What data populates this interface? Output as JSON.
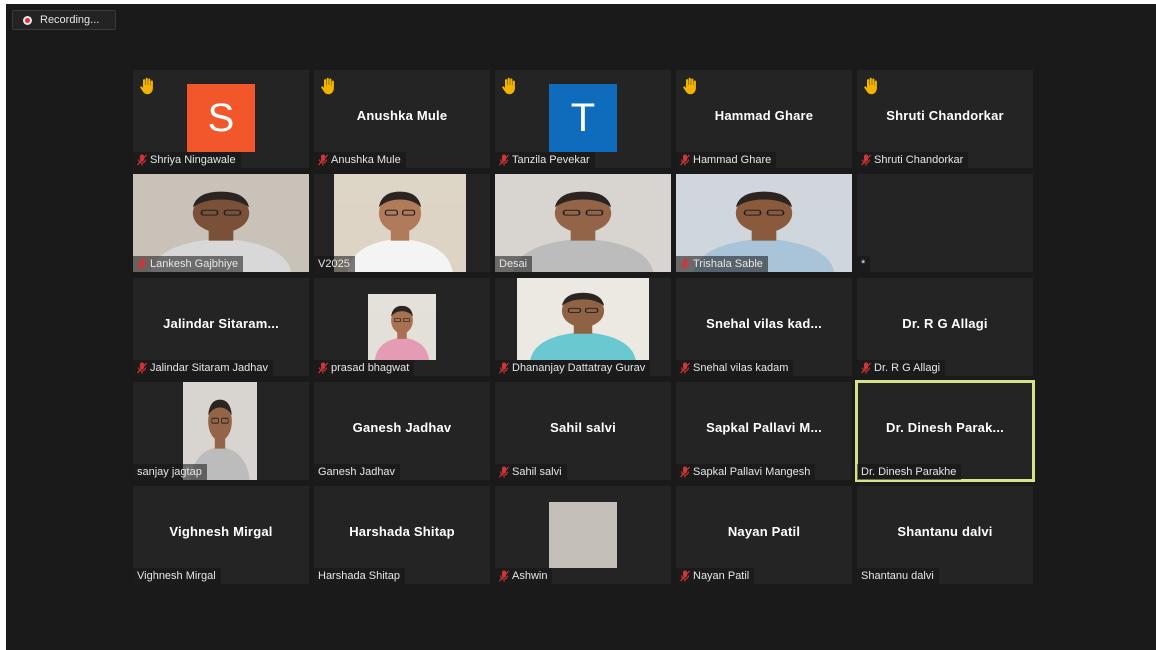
{
  "recording": {
    "label": "Recording..."
  },
  "colors": {
    "mute": "#d13438",
    "hand": "#f2b400",
    "active_border": "#d3e38a",
    "avatar_s": "#f1572a",
    "avatar_t": "#0f6cbd"
  },
  "tiles": [
    {
      "label": "Shriya Ningawale",
      "avatar_letter": "S",
      "hand": true,
      "muted": true
    },
    {
      "label": "Anushka Mule",
      "center": "Anushka Mule",
      "hand": true,
      "muted": true
    },
    {
      "label": "Tanzila Pevekar",
      "avatar_letter": "T",
      "hand": true,
      "muted": true
    },
    {
      "label": "Hammad Ghare",
      "center": "Hammad Ghare",
      "hand": true,
      "muted": true
    },
    {
      "label": "Shruti Chandorkar",
      "center": "Shruti Chandorkar",
      "hand": true,
      "muted": true
    },
    {
      "label": "Lankesh Gajbhiye",
      "video": "person",
      "muted": true
    },
    {
      "label": "V2025",
      "video": "person",
      "muted": false
    },
    {
      "label": "Desai",
      "video": "person",
      "muted": false
    },
    {
      "label": "Trishala Sable",
      "video": "person",
      "muted": true
    },
    {
      "label": "*",
      "muted": false
    },
    {
      "label": "Jalindar Sitaram Jadhav",
      "center": "Jalindar  Sitaram...",
      "muted": true
    },
    {
      "label": "prasad bhagwat",
      "video": "person",
      "muted": true
    },
    {
      "label": "Dhananjay Dattatray Gurav",
      "video": "person",
      "muted": true
    },
    {
      "label": "Snehal vilas kadam",
      "center": "Snehal  vilas  kad...",
      "muted": true
    },
    {
      "label": "Dr. R G Allagi",
      "center": "Dr. R G Allagi",
      "muted": true
    },
    {
      "label": "sanjay jagtap",
      "video": "person",
      "muted": false
    },
    {
      "label": "Ganesh Jadhav",
      "center": "Ganesh Jadhav",
      "muted": false
    },
    {
      "label": "Sahil salvi",
      "center": "Sahil salvi",
      "muted": true
    },
    {
      "label": "Sapkal Pallavi Mangesh",
      "center": "Sapkal  Pallavi  M...",
      "muted": true
    },
    {
      "label": "Dr. Dinesh Parakhe",
      "center": "Dr.  Dinesh  Parak...",
      "muted": false,
      "active": true
    },
    {
      "label": "Vighnesh Mirgal",
      "center": "Vighnesh Mirgal",
      "muted": false
    },
    {
      "label": "Harshada Shitap",
      "center": "Harshada Shitap",
      "muted": false
    },
    {
      "label": "Ashwin",
      "video": "blank",
      "muted": true
    },
    {
      "label": "Nayan Patil",
      "center": "Nayan Patil",
      "muted": true
    },
    {
      "label": "Shantanu dalvi",
      "center": "Shantanu dalvi",
      "muted": false
    }
  ]
}
